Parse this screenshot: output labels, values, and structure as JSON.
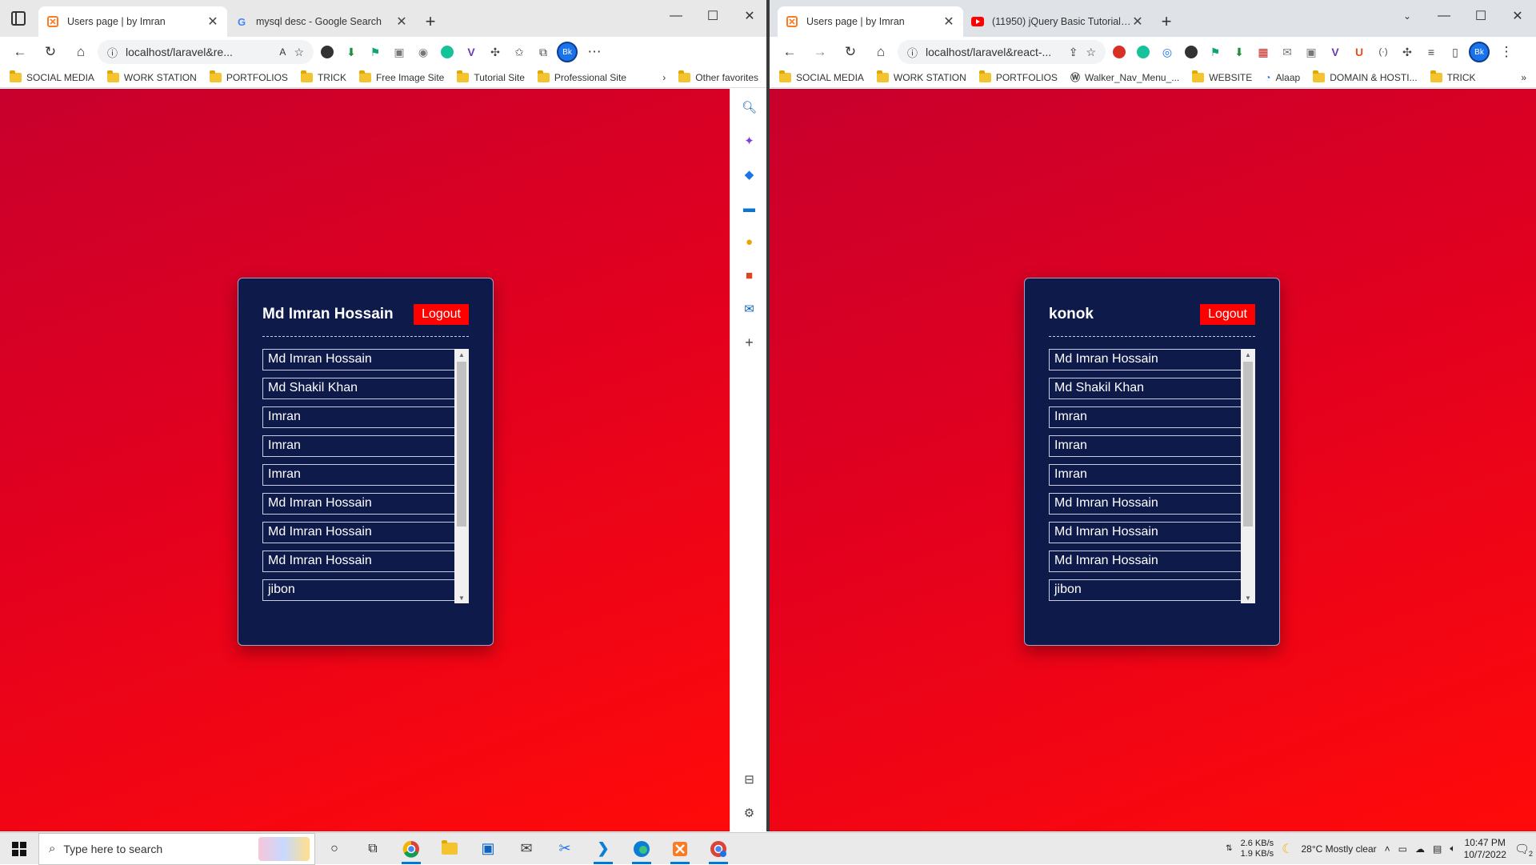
{
  "colors": {
    "page_red": "#e2001f",
    "card_bg": "#0e1a4a",
    "logout_bg": "#ff0000"
  },
  "left_browser": {
    "tabs": [
      {
        "title": "Users page | by Imran",
        "icon": "xampp-icon"
      },
      {
        "title": "mysql desc - Google Search",
        "icon": "google-icon"
      }
    ],
    "url": "localhost/laravel&re...",
    "bookmarks": [
      "SOCIAL MEDIA",
      "WORK STATION",
      "PORTFOLIOS",
      "TRICK",
      "Free Image Site",
      "Tutorial Site",
      "Professional Site"
    ],
    "other_favorites": "Other favorites",
    "avatar": "Bk",
    "card": {
      "user_name": "Md Imran Hossain",
      "logout": "Logout",
      "users": [
        "Md Imran Hossain",
        "Md Shakil Khan",
        "Imran",
        "Imran",
        "Imran",
        "Md Imran Hossain",
        "Md Imran Hossain",
        "Md Imran Hossain",
        "jibon"
      ]
    }
  },
  "right_browser": {
    "tabs": [
      {
        "title": "Users page | by Imran",
        "icon": "xampp-icon"
      },
      {
        "title": "(11950) jQuery Basic Tutorial (Ba...",
        "icon": "youtube-icon"
      }
    ],
    "url": "localhost/laravel&react-...",
    "bookmarks": [
      "SOCIAL MEDIA",
      "WORK STATION",
      "PORTFOLIOS",
      "Walker_Nav_Menu_...",
      "WEBSITE",
      "Alaap",
      "DOMAIN & HOSTI...",
      "TRICK"
    ],
    "avatar": "Bk",
    "card": {
      "user_name": "konok",
      "logout": "Logout",
      "users": [
        "Md Imran Hossain",
        "Md Shakil Khan",
        "Imran",
        "Imran",
        "Imran",
        "Md Imran Hossain",
        "Md Imran Hossain",
        "Md Imran Hossain",
        "jibon"
      ]
    }
  },
  "taskbar": {
    "search_placeholder": "Type here to search",
    "net_up": "2.6 KB/s",
    "net_down": "1.9 KB/s",
    "weather": "28°C  Mostly clear",
    "time": "10:47 PM",
    "date": "10/7/2022",
    "notifications": "2"
  }
}
